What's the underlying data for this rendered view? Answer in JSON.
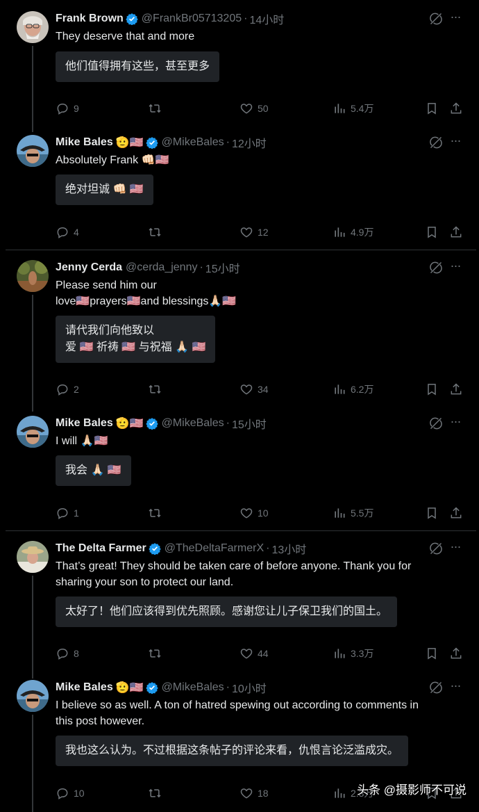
{
  "tweets": [
    {
      "name": "Frank Brown",
      "badges": "",
      "handle": "@FrankBr05713205",
      "time": "14小时",
      "text": "They deserve that and more",
      "translation": "他们值得拥有这些，甚至更多",
      "replies": "9",
      "retweets": "",
      "likes": "50",
      "views": "5.4万"
    },
    {
      "name": "Mike Bales",
      "badges": "🫡🇺🇸",
      "handle": "@MikeBales",
      "time": "12小时",
      "text": "Absolutely Frank 👊🏻🇺🇸",
      "translation": "绝对坦诚 👊🏻 🇺🇸",
      "replies": "4",
      "retweets": "",
      "likes": "12",
      "views": "4.9万"
    },
    {
      "name": "Jenny Cerda",
      "badges": "",
      "handle": "@cerda_jenny",
      "time": "15小时",
      "text_line1": "Please send him our",
      "text_line2": "love🇺🇸prayers🇺🇸and blessings🙏🏻🇺🇸",
      "translation_line1": "请代我们向他致以",
      "translation_line2": "爱 🇺🇸 祈祷 🇺🇸 与祝福 🙏🏻 🇺🇸",
      "replies": "2",
      "retweets": "",
      "likes": "34",
      "views": "6.2万"
    },
    {
      "name": "Mike Bales",
      "badges": "🫡🇺🇸",
      "handle": "@MikeBales",
      "time": "15小时",
      "text": "I will 🙏🏻🇺🇸",
      "translation": "我会 🙏🏻 🇺🇸",
      "replies": "1",
      "retweets": "",
      "likes": "10",
      "views": "5.5万"
    },
    {
      "name": "The Delta Farmer",
      "badges": "",
      "handle": "@TheDeltaFarmerX",
      "time": "13小时",
      "text_line1": "That’s great!  They should be taken care of before anyone.  Thank you for",
      "text_line2": "sharing your son to protect our land.",
      "translation": "太好了！他们应该得到优先照顾。感谢您让儿子保卫我们的国土。",
      "replies": "8",
      "retweets": "",
      "likes": "44",
      "views": "3.3万"
    },
    {
      "name": "Mike Bales",
      "badges": "🫡🇺🇸",
      "handle": "@MikeBales",
      "time": "10小时",
      "text_line1": "I believe so as well. A ton of hatred spewing out according to comments in",
      "text_line2": "this post however.",
      "translation": "我也这么认为。不过根据这条帖子的评论来看，仇恨言论泛滥成灾。",
      "replies": "10",
      "retweets": "",
      "likes": "18",
      "views": "2.3万"
    }
  ],
  "watermark": "头条 @摄影师不可说",
  "colors": {
    "background": "#000000",
    "text": "#e7e9ea",
    "muted": "#71767b",
    "verified": "#1d9bf0",
    "translate_bg": "#202327"
  }
}
